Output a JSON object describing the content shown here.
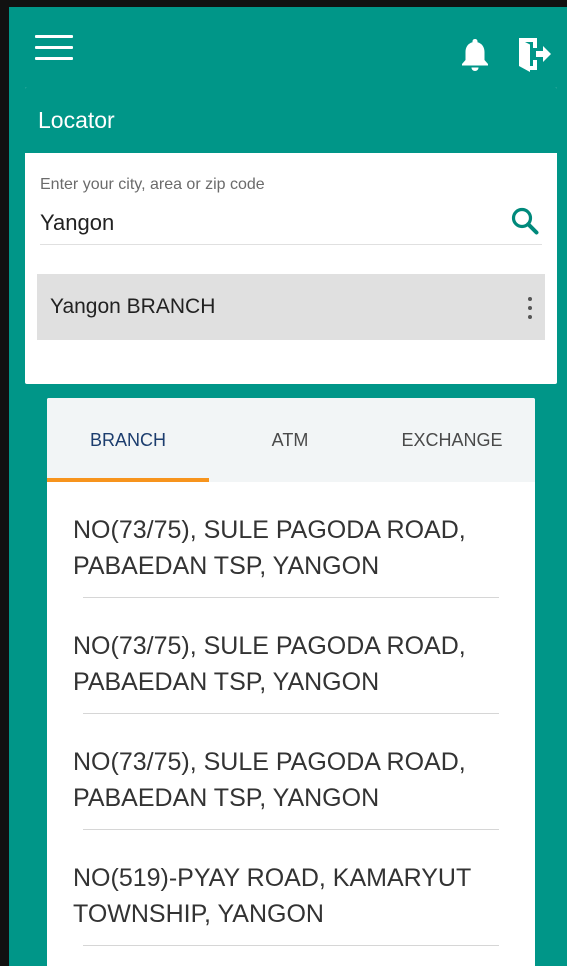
{
  "header": {
    "menu_icon": "hamburger-menu-icon",
    "notification_icon": "bell-icon",
    "logout_icon": "logout-icon",
    "accent_color": "#009688"
  },
  "locator": {
    "title": "Locator",
    "search": {
      "label": "Enter your city, area or zip code",
      "value": "Yangon",
      "icon": "search-icon"
    },
    "suggestion": {
      "label": "Yangon BRANCH",
      "more_icon": "more-vertical-icon"
    }
  },
  "results": {
    "tabs": [
      {
        "label": "BRANCH",
        "active": true
      },
      {
        "label": "ATM",
        "active": false
      },
      {
        "label": "EXCHANGE",
        "active": false
      }
    ],
    "indicator_color": "#f7941d",
    "items": [
      {
        "address": "NO(73/75), SULE PAGODA ROAD, PABAEDAN TSP, YANGON"
      },
      {
        "address": "NO(73/75), SULE PAGODA ROAD, PABAEDAN TSP, YANGON"
      },
      {
        "address": "NO(73/75), SULE PAGODA ROAD, PABAEDAN TSP, YANGON"
      },
      {
        "address": "NO(519)-PYAY ROAD, KAMARYUT TOWNSHIP, YANGON"
      }
    ]
  }
}
